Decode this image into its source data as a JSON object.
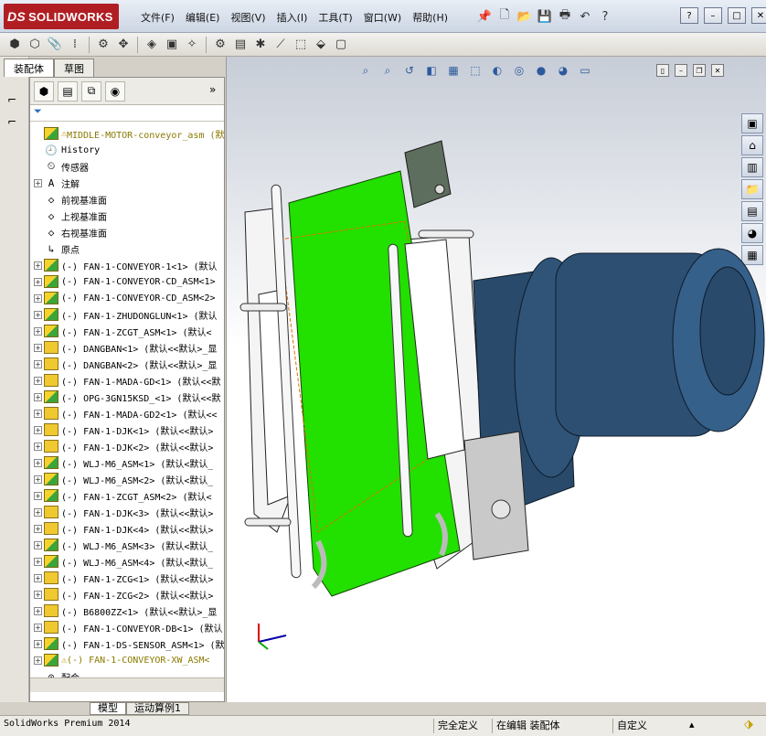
{
  "app": {
    "logo_prefix": "DS",
    "logo_text": "SOLIDWORKS"
  },
  "menu": [
    "文件(F)",
    "编辑(E)",
    "视图(V)",
    "插入(I)",
    "工具(T)",
    "窗口(W)",
    "帮助(H)"
  ],
  "window_buttons": [
    "?",
    "–",
    "□",
    "✕"
  ],
  "manager_tabs": [
    "装配体",
    "草图"
  ],
  "tree": {
    "root": "MIDDLE-MOTOR-conveyor_asm  (默",
    "items": [
      {
        "label": "History",
        "icon": "history-icon",
        "expand": false
      },
      {
        "label": "传感器",
        "icon": "sensor-icon",
        "expand": false
      },
      {
        "label": "注解",
        "icon": "annotation-icon",
        "expand": true
      },
      {
        "label": "前视基准面",
        "icon": "plane-icon",
        "expand": false
      },
      {
        "label": "上视基准面",
        "icon": "plane-icon",
        "expand": false
      },
      {
        "label": "右视基准面",
        "icon": "plane-icon",
        "expand": false
      },
      {
        "label": "原点",
        "icon": "origin-icon",
        "expand": false
      },
      {
        "label": "(-) FAN-1-CONVEYOR-1<1>  (默认",
        "icon": "assembly-icon",
        "expand": true
      },
      {
        "label": "(-) FAN-1-CONVEYOR-CD_ASM<1>",
        "icon": "assembly-icon",
        "expand": true
      },
      {
        "label": "(-) FAN-1-CONVEYOR-CD_ASM<2>",
        "icon": "assembly-icon",
        "expand": true
      },
      {
        "label": "(-) FAN-1-ZHUDONGLUN<1>  (默认",
        "icon": "assembly-icon",
        "expand": true
      },
      {
        "label": "(-) FAN-1-ZCGT_ASM<1>  (默认<",
        "icon": "assembly-icon",
        "expand": true
      },
      {
        "label": "(-) DANGBAN<1>  (默认<<默认>_显",
        "icon": "part-icon",
        "expand": true
      },
      {
        "label": "(-) DANGBAN<2>  (默认<<默认>_显",
        "icon": "part-icon",
        "expand": true
      },
      {
        "label": "(-) FAN-1-MADA-GD<1>  (默认<<默",
        "icon": "part-icon",
        "expand": true
      },
      {
        "label": "(-) OPG-3GN15KSD_<1>  (默认<<默",
        "icon": "assembly-icon",
        "expand": true
      },
      {
        "label": "(-) FAN-1-MADA-GD2<1>  (默认<<",
        "icon": "part-icon",
        "expand": true
      },
      {
        "label": "(-) FAN-1-DJK<1>  (默认<<默认>",
        "icon": "part-icon",
        "expand": true
      },
      {
        "label": "(-) FAN-1-DJK<2>  (默认<<默认>",
        "icon": "part-icon",
        "expand": true
      },
      {
        "label": "(-) WLJ-M6_ASM<1>  (默认<默认_",
        "icon": "assembly-icon",
        "expand": true
      },
      {
        "label": "(-) WLJ-M6_ASM<2>  (默认<默认_",
        "icon": "assembly-icon",
        "expand": true
      },
      {
        "label": "(-) FAN-1-ZCGT_ASM<2>  (默认<",
        "icon": "assembly-icon",
        "expand": true
      },
      {
        "label": "(-) FAN-1-DJK<3>  (默认<<默认>",
        "icon": "part-icon",
        "expand": true
      },
      {
        "label": "(-) FAN-1-DJK<4>  (默认<<默认>",
        "icon": "part-icon",
        "expand": true
      },
      {
        "label": "(-) WLJ-M6_ASM<3>  (默认<默认_",
        "icon": "assembly-icon",
        "expand": true
      },
      {
        "label": "(-) WLJ-M6_ASM<4>  (默认<默认_",
        "icon": "assembly-icon",
        "expand": true
      },
      {
        "label": "(-) FAN-1-ZCG<1>  (默认<<默认>",
        "icon": "part-icon",
        "expand": true
      },
      {
        "label": "(-) FAN-1-ZCG<2>  (默认<<默认>",
        "icon": "part-icon",
        "expand": true
      },
      {
        "label": "(-) B6800ZZ<1>  (默认<<默认>_显",
        "icon": "part-icon",
        "expand": true
      },
      {
        "label": "(-) FAN-1-CONVEYOR-DB<1>  (默认",
        "icon": "part-icon",
        "expand": true
      },
      {
        "label": "(-) FAN-1-DS-SENSOR_ASM<1>  (默",
        "icon": "assembly-icon",
        "expand": true
      },
      {
        "label": "(-) FAN-1-CONVEYOR-XW_ASM<",
        "icon": "assembly-icon",
        "expand": true,
        "warning": true
      },
      {
        "label": "配合",
        "icon": "mates-icon",
        "expand": false
      }
    ]
  },
  "bottom_tabs": [
    "模型",
    "运动算例1"
  ],
  "status": {
    "app_name": "SolidWorks Premium 2014",
    "definition": "完全定义",
    "editing": "在编辑 装配体",
    "units": "自定义"
  },
  "colors": {
    "belt": "#22e000",
    "motor": "#2a4a6b",
    "frame": "#f2f2f2",
    "brand": "#b01e23"
  }
}
